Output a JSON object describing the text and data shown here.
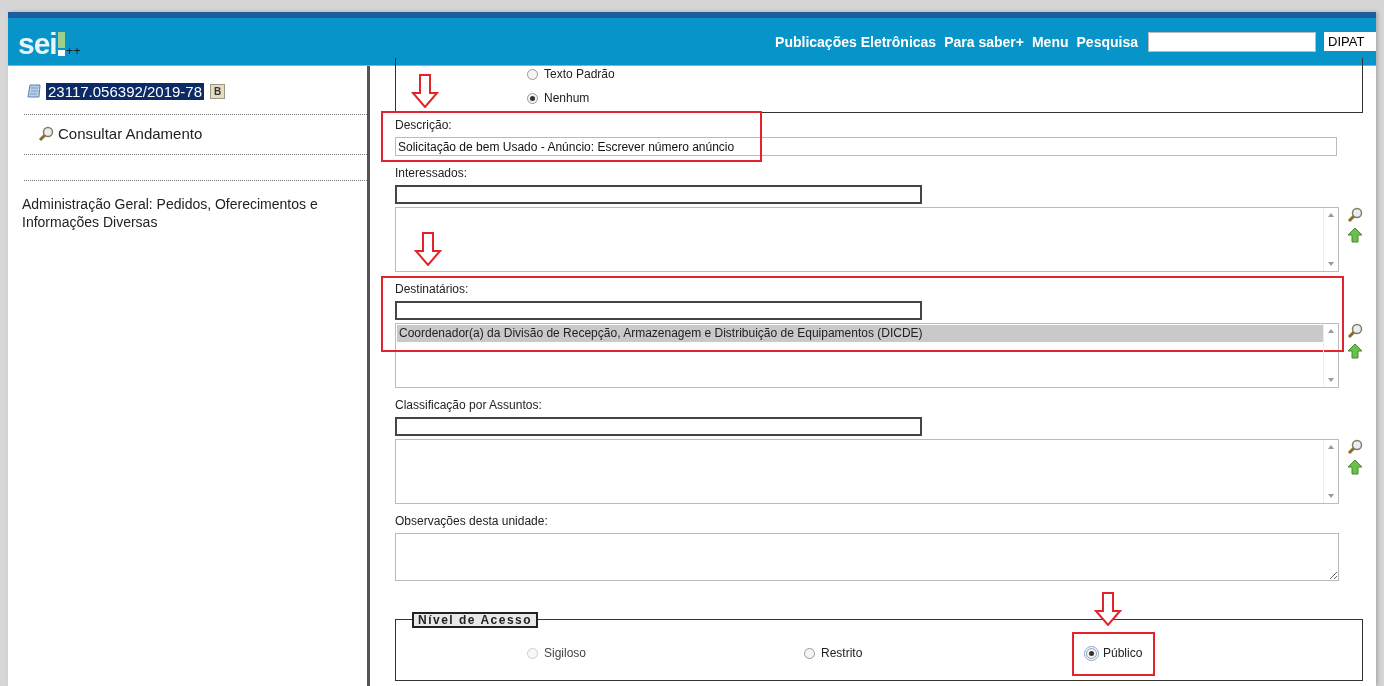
{
  "header": {
    "logo": "sei",
    "logo_suffix": "++",
    "nav": [
      {
        "label": "Publicações Eletrônicas"
      },
      {
        "label": "Para saber+"
      },
      {
        "label": "Menu"
      },
      {
        "label": "Pesquisa"
      }
    ],
    "unit": "DIPAT"
  },
  "sidebar": {
    "process_number": "23117.056392/2019-78",
    "process_selected": true,
    "badge": "B",
    "link": "Consultar Andamento",
    "type": "Administração Geral: Pedidos, Oferecimentos e Informações Diversas"
  },
  "form": {
    "text_options": [
      {
        "label": "Texto Padrão",
        "selected": false
      },
      {
        "label": "Nenhum",
        "selected": true
      }
    ],
    "fields": [
      {
        "kind": "text",
        "label": "Descrição:",
        "value": "Solicitação de bem Usado - Anúncio: Escrever número anúncio",
        "highlighted": true
      },
      {
        "kind": "lookup",
        "label": "Interessados:",
        "highlighted": false
      },
      {
        "kind": "lookup",
        "label": "Destinatários:",
        "items": [
          {
            "text": "Coordenador(a) da Divisão de Recepção, Armazenagem e Distribuição de Equipamentos (DICDE)",
            "selected": true
          }
        ],
        "highlighted": true
      },
      {
        "kind": "lookup",
        "label": "Classificação por Assuntos:",
        "highlighted": false
      },
      {
        "kind": "textarea",
        "label": "Observações desta unidade:",
        "highlighted": false
      }
    ],
    "access_level": {
      "legend": "Nível de Acesso",
      "options": [
        {
          "label": "Sigiloso",
          "selected": false,
          "disabled": true,
          "highlighted": false
        },
        {
          "label": "Restrito",
          "selected": false,
          "disabled": false,
          "highlighted": false
        },
        {
          "label": "Público",
          "selected": true,
          "disabled": false,
          "highlighted": true
        }
      ]
    }
  }
}
